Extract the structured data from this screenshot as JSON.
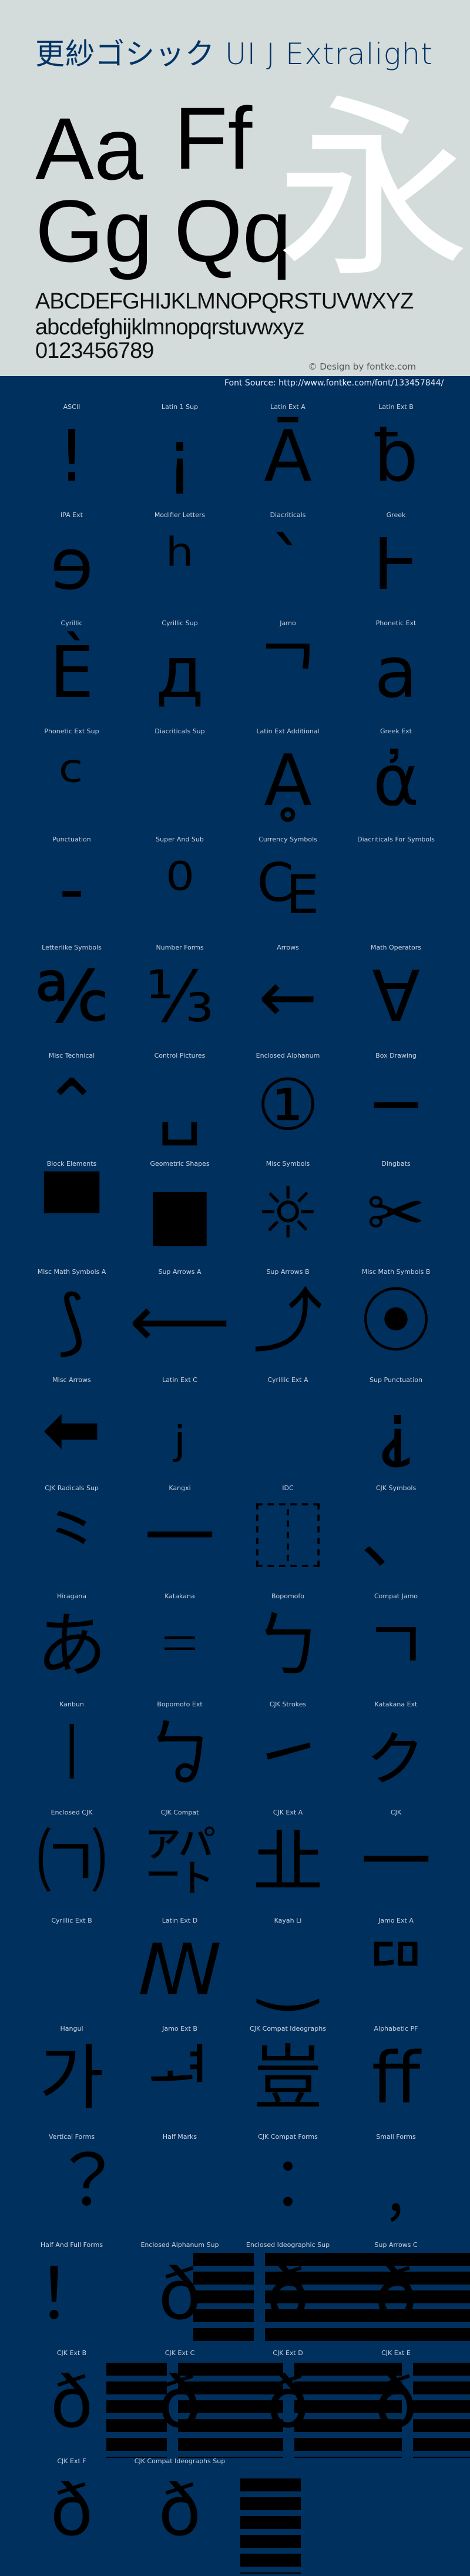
{
  "header": {
    "title": "更紗ゴシック UI J Extralight",
    "sample_upper_1": "Aa",
    "sample_upper_2": "Ff",
    "sample_lower_1": "Gg",
    "sample_lower_2": "Qq",
    "sample_kanji": "永",
    "uppercase": "ABCDEFGHIJKLMNOPQRSTUVWXYZ",
    "lowercase": "abcdefghijklmnopqrstuvwxyz",
    "digits": "0123456789",
    "credit": "© Design by fontke.com",
    "font_source": "Font Source: http://www.fontke.com/font/133457844/"
  },
  "colors": {
    "header_bg": "#d3dbdb",
    "panel_bg": "#00305e",
    "title": "#003366"
  },
  "blocks": [
    {
      "label": "ASCII",
      "glyph": "!"
    },
    {
      "label": "Latin 1 Sup",
      "glyph": "¡"
    },
    {
      "label": "Latin Ext A",
      "glyph": "Ā"
    },
    {
      "label": "Latin Ext B",
      "glyph": "ƀ"
    },
    {
      "label": "IPA Ext",
      "glyph": "ɘ"
    },
    {
      "label": "Modifier Letters",
      "glyph": "ʰ"
    },
    {
      "label": "Diacriticals",
      "glyph": "ˋ"
    },
    {
      "label": "Greek",
      "glyph": "Ͱ"
    },
    {
      "label": "Cyrillic",
      "glyph": "Ѐ"
    },
    {
      "label": "Cyrillic Sup",
      "glyph": "д"
    },
    {
      "label": "Jamo",
      "glyph": "ᄀ"
    },
    {
      "label": "Phonetic Ext",
      "glyph": "a"
    },
    {
      "label": "Phonetic Ext Sup",
      "glyph": "ᶜ"
    },
    {
      "label": "Diacriticals Sup",
      "glyph": ""
    },
    {
      "label": "Latin Ext Additional",
      "glyph": "Ḁ"
    },
    {
      "label": "Greek Ext",
      "glyph": "ἀ"
    },
    {
      "label": "Punctuation",
      "glyph": "‐"
    },
    {
      "label": "Super And Sub",
      "glyph": "⁰"
    },
    {
      "label": "Currency Symbols",
      "glyph": "₠"
    },
    {
      "label": "Diacriticals For Symbols",
      "glyph": ""
    },
    {
      "label": "Letterlike Symbols",
      "glyph": "℀"
    },
    {
      "label": "Number Forms",
      "glyph": "⅓"
    },
    {
      "label": "Arrows",
      "glyph": "←"
    },
    {
      "label": "Math Operators",
      "glyph": "∀"
    },
    {
      "label": "Misc Technical",
      "glyph": "⌃"
    },
    {
      "label": "Control Pictures",
      "glyph": "␣"
    },
    {
      "label": "Enclosed Alphanum",
      "glyph": "①"
    },
    {
      "label": "Box Drawing",
      "glyph": "─"
    },
    {
      "label": "Block Elements",
      "glyph": "▀"
    },
    {
      "label": "Geometric Shapes",
      "glyph": "■"
    },
    {
      "label": "Misc Symbols",
      "glyph": "☼"
    },
    {
      "label": "Dingbats",
      "glyph": "✂"
    },
    {
      "label": "Misc Math Symbols A",
      "glyph": "⟆"
    },
    {
      "label": "Sup Arrows A",
      "glyph": "⟵"
    },
    {
      "label": "Sup Arrows B",
      "glyph": "⤴"
    },
    {
      "label": "Misc Math Symbols B",
      "glyph": "⦿"
    },
    {
      "label": "Misc Arrows",
      "glyph": "⬅"
    },
    {
      "label": "Latin Ext C",
      "glyph": "ⱼ"
    },
    {
      "label": "Cyrillic Ext A",
      "glyph": ""
    },
    {
      "label": "Sup Punctuation",
      "glyph": "⸘"
    },
    {
      "label": "CJK Radicals Sup",
      "glyph": "⺀"
    },
    {
      "label": "Kangxi",
      "glyph": "⼀"
    },
    {
      "label": "IDC",
      "glyph": "⿰"
    },
    {
      "label": "CJK Symbols",
      "glyph": "、"
    },
    {
      "label": "Hiragana",
      "glyph": "あ"
    },
    {
      "label": "Katakana",
      "glyph": "゠"
    },
    {
      "label": "Bopomofo",
      "glyph": "ㄅ"
    },
    {
      "label": "Compat Jamo",
      "glyph": "ㄱ"
    },
    {
      "label": "Kanbun",
      "glyph": "㆐"
    },
    {
      "label": "Bopomofo Ext",
      "glyph": "ㆠ"
    },
    {
      "label": "CJK Strokes",
      "glyph": "㇀"
    },
    {
      "label": "Katakana Ext",
      "glyph": "ㇰ"
    },
    {
      "label": "Enclosed CJK",
      "glyph": "㈀"
    },
    {
      "label": "CJK Compat",
      "glyph": "㌀"
    },
    {
      "label": "CJK Ext A",
      "glyph": "㐀"
    },
    {
      "label": "CJK",
      "glyph": "一"
    },
    {
      "label": "Cyrillic Ext B",
      "glyph": ""
    },
    {
      "label": "Latin Ext D",
      "glyph": "ꟿ"
    },
    {
      "label": "Kayah Li",
      "glyph": "‿"
    },
    {
      "label": "Jamo Ext A",
      "glyph": "ꥠ"
    },
    {
      "label": "Hangul",
      "glyph": "가"
    },
    {
      "label": "Jamo Ext B",
      "glyph": "ힰ"
    },
    {
      "label": "CJK Compat Ideographs",
      "glyph": "豈"
    },
    {
      "label": "Alphabetic PF",
      "glyph": "ﬀ"
    },
    {
      "label": "Vertical Forms",
      "glyph": "︖"
    },
    {
      "label": "Half Marks",
      "glyph": ""
    },
    {
      "label": "CJK Compat Forms",
      "glyph": "︰"
    },
    {
      "label": "Small Forms",
      "glyph": "﹐"
    },
    {
      "label": "Half And Full Forms",
      "glyph": "！"
    },
    {
      "label": "Enclosed Alphanum Sup",
      "glyph": "ð"
    },
    {
      "label": "Enclosed Ideographic Sup",
      "glyph": "ð"
    },
    {
      "label": "Sup Arrows C",
      "glyph": "ð"
    },
    {
      "label": "CJK Ext B",
      "glyph": "ð"
    },
    {
      "label": "CJK Ext C",
      "glyph": "ð"
    },
    {
      "label": "CJK Ext D",
      "glyph": "ð"
    },
    {
      "label": "CJK Ext E",
      "glyph": "ð"
    },
    {
      "label": "CJK Ext F",
      "glyph": "ð"
    },
    {
      "label": "CJK Compat Ideographs Sup",
      "glyph": "ð"
    }
  ]
}
